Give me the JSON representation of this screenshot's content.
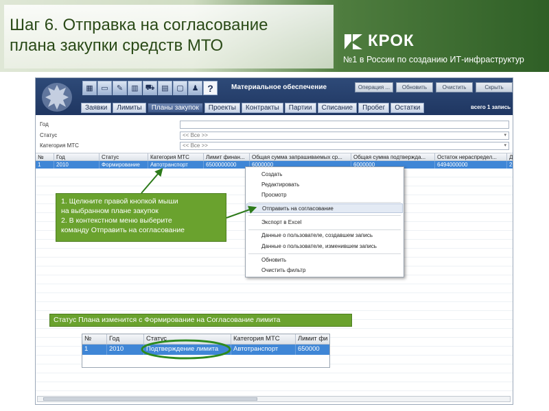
{
  "slide": {
    "title_line1": "Шаг 6. Отправка на согласование",
    "title_line2": "плана закупки средств МТО"
  },
  "brand": {
    "name": "КРОК",
    "tagline": "№1 в России по созданию ИТ-инфраструктур"
  },
  "app": {
    "module_title": "Материальное обеспечение",
    "top_buttons": [
      "Операция ...",
      "Обновить",
      "Очистить",
      "Скрыть"
    ],
    "nav_tabs": [
      "Заявки",
      "Лимиты",
      "Планы закупок",
      "Проекты",
      "Контракты",
      "Партии",
      "Списание",
      "Пробег",
      "Остатки"
    ],
    "active_tab": "Планы закупок",
    "total_count": "всего 1 запись",
    "filters": [
      {
        "label": "Год",
        "value": ""
      },
      {
        "label": "Статус",
        "value": "<< Все >>"
      },
      {
        "label": "Категория МТС",
        "value": "<< Все >>"
      }
    ],
    "grid": {
      "columns": [
        "№",
        "Год",
        "Статус",
        "Категория МТС",
        "Лимит финан...",
        "Общая сумма запрашиваемых ср...",
        "Общая сумма подтвержда...",
        "Остаток нераспредел...",
        "Д"
      ],
      "row": [
        "1",
        "2010",
        "Формирование",
        "Автотранспорт",
        "6500000000",
        "6000000",
        "6000000",
        "6494000000",
        "2"
      ]
    }
  },
  "context_menu": {
    "items": [
      "Создать",
      "Редактировать",
      "Просмотр",
      "Отправить на согласование",
      "Экспорт в Excel",
      "Данные о пользователе, создавшем запись",
      "Данные о пользователе, изменившем запись",
      "Обновить",
      "Очистить фильтр"
    ],
    "highlighted": "Отправить на согласование"
  },
  "callouts": {
    "instructions": [
      "1. Щелкните правой кнопкой мыши",
      "на выбранном плане закупок",
      "2. В контекстном меню выберите",
      "команду Отправить на согласование"
    ],
    "status_note": "Статус Плана изменится с Формирование на Согласование лимита"
  },
  "result_grid": {
    "columns": [
      "№",
      "Год",
      "Статус",
      "Категория МТС",
      "Лимит фи"
    ],
    "row": [
      "1",
      "2010",
      "Подтверждение лимита",
      "Автотранспорт",
      "650000"
    ]
  },
  "colors": {
    "callout_green": "#6aa22e",
    "selection_blue": "#3f86d6",
    "app_header_navy": "#1f3661",
    "highlight_ellipse": "#2d8a1e"
  },
  "icons": [
    "emblem-icon",
    "toolbar-icons",
    "help-icon",
    "dropdown-arrow-icon"
  ]
}
